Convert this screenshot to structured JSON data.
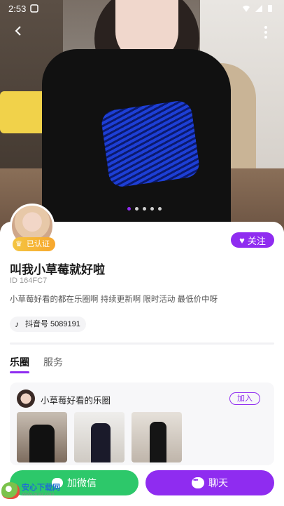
{
  "status_bar": {
    "time": "2:53"
  },
  "profile": {
    "verified_label": "已认证",
    "follow_label": "关注",
    "name": "叫我小草莓就好啦",
    "id_text": "ID  164FC7",
    "bio": "小草莓好看的都在乐圈啊 持续更新啊 限时活动 最低价中呀",
    "douyin_label": "抖音号 5089191"
  },
  "tabs": [
    {
      "label": "乐圈",
      "active": true
    },
    {
      "label": "服务",
      "active": false
    }
  ],
  "group": {
    "name": "小草莓好看的乐圈",
    "join_label": "加入"
  },
  "bottom": {
    "wechat_label": "加微信",
    "chat_label": "聊天"
  },
  "watermark": {
    "title": "安心下载网",
    "sub": "www.anxz.com"
  },
  "colors": {
    "accent": "#8f2cf0",
    "wechat_green": "#2dc86a",
    "verified_gold": "#f4c542"
  }
}
